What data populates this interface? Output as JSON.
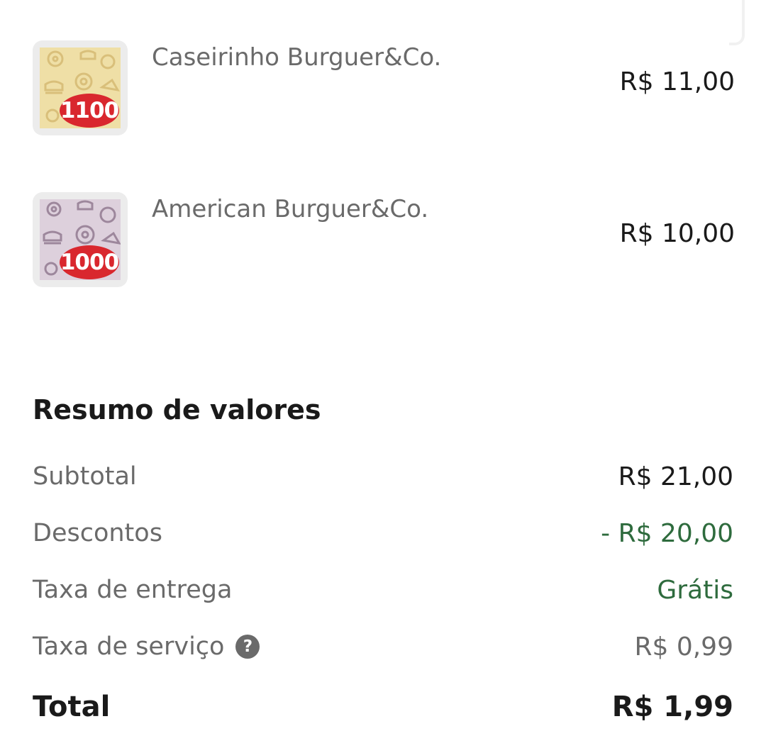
{
  "items": [
    {
      "name": "Caseirinho Burguer&Co.",
      "badge": "1100",
      "price": "R$ 11,00",
      "bg": "#efdfa6",
      "pattern": "#d9bf7a"
    },
    {
      "name": "American Burguer&Co.",
      "badge": "1000",
      "price": "R$ 10,00",
      "bg": "#ddd0dc",
      "pattern": "#9d879c"
    }
  ],
  "summary": {
    "title": "Resumo de valores",
    "subtotal": {
      "label": "Subtotal",
      "value": "R$ 21,00"
    },
    "discounts": {
      "label": "Descontos",
      "value": "- R$ 20,00"
    },
    "delivery": {
      "label": "Taxa de entrega",
      "value": "Grátis"
    },
    "service": {
      "label": "Taxa de serviço",
      "value": "R$ 0,99",
      "help_icon": "?"
    },
    "total": {
      "label": "Total",
      "value": "R$ 1,99"
    }
  },
  "colors": {
    "brand_red": "#d9272e",
    "discount_green": "#2e6b3d",
    "muted_text": "#6a6a6a",
    "primary_text": "#1a1a1a"
  },
  "icons": {
    "help": "question-circle-icon"
  }
}
